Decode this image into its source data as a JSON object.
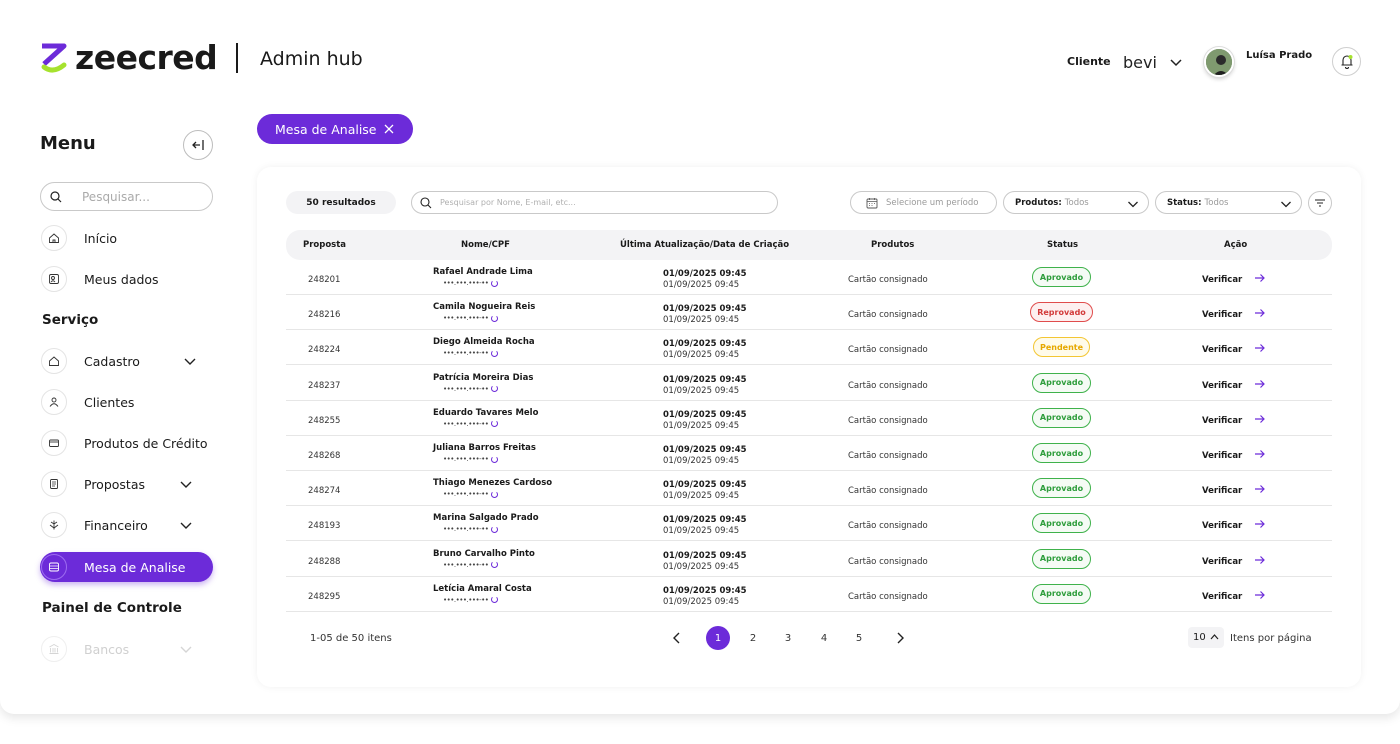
{
  "header": {
    "logo_text": "zeecred",
    "hub_title": "Admin hub",
    "client_label": "Cliente",
    "client_value": "bevi",
    "user_name": "Luísa Prado"
  },
  "sidebar": {
    "menu_title": "Menu",
    "search_placeholder": "Pesquisar...",
    "top_items": [
      {
        "label": "Início",
        "icon": "home-icon"
      },
      {
        "label": "Meus dados",
        "icon": "user-data-icon"
      }
    ],
    "service_title": "Serviço",
    "service_items": [
      {
        "label": "Cadastro",
        "icon": "home-icon",
        "expandable": true
      },
      {
        "label": "Clientes",
        "icon": "clients-icon"
      },
      {
        "label": "Produtos de Crédito",
        "icon": "card-icon"
      },
      {
        "label": "Propostas",
        "icon": "document-icon",
        "expandable": true
      },
      {
        "label": "Financeiro",
        "icon": "finance-icon",
        "expandable": true
      },
      {
        "label": "Mesa de Analise",
        "icon": "analysis-icon",
        "active": true
      }
    ],
    "control_title": "Painel de Controle",
    "control_items": [
      {
        "label": "Bancos",
        "icon": "bank-icon",
        "expandable": true
      }
    ]
  },
  "chip": {
    "label": "Mesa de Analise"
  },
  "toolbar": {
    "results": "50 resultados",
    "search_placeholder": "Pesquisar por Nome, E-mail, etc...",
    "period_placeholder": "Selecione um período",
    "products_label": "Produtos:",
    "products_value": "Todos",
    "status_label": "Status:",
    "status_value": "Todos"
  },
  "table": {
    "columns": [
      "Proposta",
      "Nome/CPF",
      "Última Atualização/Data de Criação",
      "Produtos",
      "Status",
      "Ação"
    ],
    "rows": [
      {
        "id": "248201",
        "name": "Rafael Andrade Lima",
        "cpf": "•••.•••.•••-••",
        "updated": "01/09/2025 09:45",
        "created": "01/09/2025 09:45",
        "product": "Cartão consignado",
        "status": "Aprovado",
        "kind": "ok",
        "action": "Verificar"
      },
      {
        "id": "248216",
        "name": "Camila Nogueira Reis",
        "cpf": "•••.•••.•••-••",
        "updated": "01/09/2025 09:45",
        "created": "01/09/2025 09:45",
        "product": "Cartão consignado",
        "status": "Reprovado",
        "kind": "bad",
        "action": "Verificar"
      },
      {
        "id": "248224",
        "name": "Diego Almeida Rocha",
        "cpf": "•••.•••.•••-••",
        "updated": "01/09/2025 09:45",
        "created": "01/09/2025 09:45",
        "product": "Cartão consignado",
        "status": "Pendente",
        "kind": "pend",
        "action": "Verificar"
      },
      {
        "id": "248237",
        "name": "Patrícia Moreira Dias",
        "cpf": "•••.•••.•••-••",
        "updated": "01/09/2025 09:45",
        "created": "01/09/2025 09:45",
        "product": "Cartão consignado",
        "status": "Aprovado",
        "kind": "ok",
        "action": "Verificar"
      },
      {
        "id": "248255",
        "name": "Eduardo Tavares Melo",
        "cpf": "•••.•••.•••-••",
        "updated": "01/09/2025 09:45",
        "created": "01/09/2025 09:45",
        "product": "Cartão consignado",
        "status": "Aprovado",
        "kind": "ok",
        "action": "Verificar"
      },
      {
        "id": "248268",
        "name": "Juliana Barros Freitas",
        "cpf": "•••.•••.•••-••",
        "updated": "01/09/2025 09:45",
        "created": "01/09/2025 09:45",
        "product": "Cartão consignado",
        "status": "Aprovado",
        "kind": "ok",
        "action": "Verificar"
      },
      {
        "id": "248274",
        "name": "Thiago Menezes Cardoso",
        "cpf": "•••.•••.•••-••",
        "updated": "01/09/2025 09:45",
        "created": "01/09/2025 09:45",
        "product": "Cartão consignado",
        "status": "Aprovado",
        "kind": "ok",
        "action": "Verificar"
      },
      {
        "id": "248193",
        "name": "Marina Salgado Prado",
        "cpf": "•••.•••.•••-••",
        "updated": "01/09/2025 09:45",
        "created": "01/09/2025 09:45",
        "product": "Cartão consignado",
        "status": "Aprovado",
        "kind": "ok",
        "action": "Verificar"
      },
      {
        "id": "248288",
        "name": "Bruno Carvalho Pinto",
        "cpf": "•••.•••.•••-••",
        "updated": "01/09/2025 09:45",
        "created": "01/09/2025 09:45",
        "product": "Cartão consignado",
        "status": "Aprovado",
        "kind": "ok",
        "action": "Verificar"
      },
      {
        "id": "248295",
        "name": "Letícia Amaral Costa",
        "cpf": "•••.•••.•••-••",
        "updated": "01/09/2025 09:45",
        "created": "01/09/2025 09:45",
        "product": "Cartão consignado",
        "status": "Aprovado",
        "kind": "ok",
        "action": "Verificar"
      }
    ]
  },
  "pagination": {
    "info": "1-05 de 50 itens",
    "pages": [
      "1",
      "2",
      "3",
      "4",
      "5"
    ],
    "current": "1",
    "per_page": "10",
    "per_page_label": "Itens por página"
  },
  "colors": {
    "accent": "#6c2bd9",
    "logo_green": "#a6e22e",
    "approved": "#3fb24b",
    "rejected": "#e04c4c",
    "pending": "#f3c633"
  }
}
